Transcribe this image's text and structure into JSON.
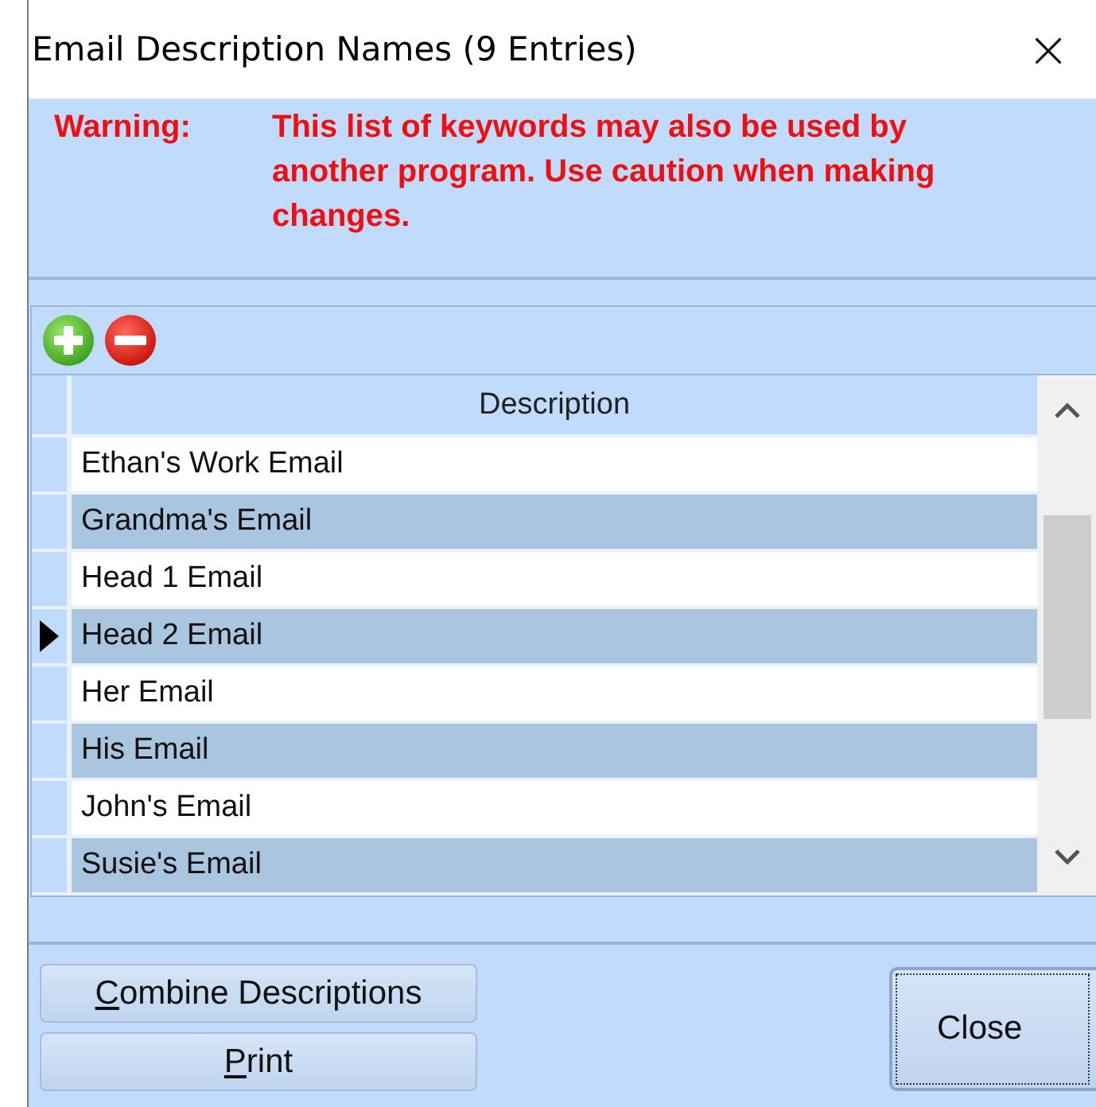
{
  "window": {
    "title": "Email Description Names (9 Entries)",
    "close_glyph": "×"
  },
  "warning": {
    "label": "Warning:",
    "message": "This list of keywords may also be used by another program. Use caution when making changes."
  },
  "table": {
    "columns": [
      "Description"
    ],
    "rows": [
      {
        "description": "Ethan's Work Email",
        "selected": false
      },
      {
        "description": "Grandma's Email",
        "selected": false
      },
      {
        "description": "Head 1 Email",
        "selected": false
      },
      {
        "description": "Head 2 Email",
        "selected": true
      },
      {
        "description": "Her Email",
        "selected": false
      },
      {
        "description": "His Email",
        "selected": false
      },
      {
        "description": "John's Email",
        "selected": false
      },
      {
        "description": "Susie's Email",
        "selected": false
      }
    ]
  },
  "buttons": [
    {
      "access_key": "C",
      "rest": "ombine Descriptions"
    },
    {
      "access_key": "P",
      "rest": "rint"
    }
  ],
  "close_button": {
    "label": "Close"
  }
}
